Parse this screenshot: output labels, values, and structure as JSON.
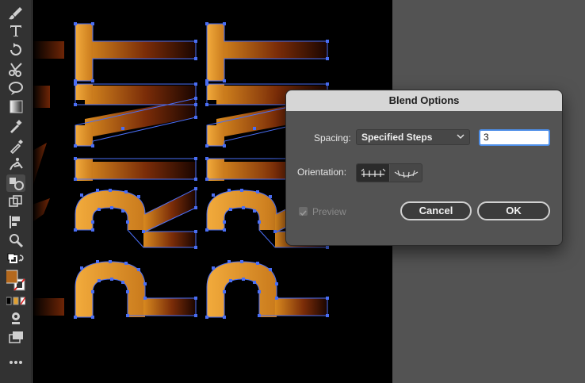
{
  "dialog": {
    "title": "Blend Options",
    "spacing_label": "Spacing:",
    "spacing_value": "Specified Steps",
    "steps_value": "3",
    "orientation_label": "Orientation:",
    "preview_label": "Preview",
    "cancel_label": "Cancel",
    "ok_label": "OK"
  },
  "canvas": {
    "artwork_text": "PRINT"
  },
  "colors": {
    "gradient_light": "#f0a838",
    "gradient_dark": "#5a1d05",
    "selection": "#4a6ef5",
    "dialog_title_bg": "#d6d6d6",
    "focus_ring": "#4d8ee8"
  },
  "toolbar": {
    "tools": [
      "paintbrush-icon",
      "type-icon",
      "rotate-icon",
      "scissors-icon",
      "warp-icon",
      "gradient-icon",
      "eyedropper-paint-icon",
      "eyedropper-icon",
      "puppet-warp-icon",
      "blend-tool-icon",
      "shape-builder-icon",
      "symbol-sprayer-icon",
      "zoom-icon"
    ]
  }
}
